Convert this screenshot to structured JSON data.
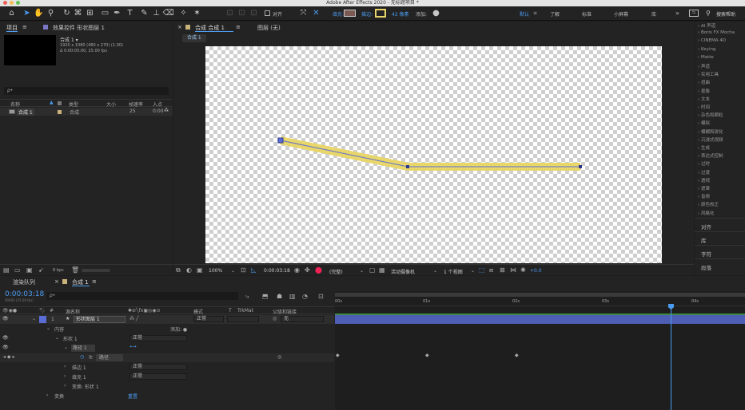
{
  "window": {
    "title": "Adobe After Effects 2020 - 无标题项目 *"
  },
  "toolbar": {
    "snap_label": "对齐",
    "fill_label": "填充:",
    "stroke_label": "描边:",
    "stroke_width": "42 像素",
    "add_label": "添加:",
    "workspaces": [
      "默认",
      "了解",
      "标准",
      "小屏幕",
      "库"
    ],
    "more": "»",
    "search_placeholder": "搜索帮助",
    "colors": {
      "fill": "#7a5a52",
      "stroke": "#e8d66a",
      "accent": "#4b9cf0"
    }
  },
  "project_panel": {
    "tab": "项目",
    "effects_tab": "效果控件 形状图层 1",
    "comp_name": "合成 1 ▾",
    "comp_info1": "1920 x 1080 (480 x 270) (1.00)",
    "comp_info2": "Δ 0:00:05:00, 25.00 fps",
    "search_icon": "ρ•",
    "columns": [
      "名称",
      "类型",
      "大小",
      "帧速率",
      "入点"
    ],
    "items": [
      {
        "name": "合成 1",
        "type": "合成",
        "fps": "25",
        "in": "0:00"
      }
    ],
    "bpc": "8 bpc"
  },
  "comp_viewer": {
    "tab": "合成 合成 1",
    "layer_tab": "图层 (无)",
    "breadcrumb": "合成 1",
    "zoom": "100%",
    "timecode": "0:00:03:18",
    "resolution": "(完整)",
    "camera": "活动摄像机",
    "views": "1 个视图",
    "exposure": "+0.0"
  },
  "effects_list": {
    "items": [
      "AI 声道",
      "Boris FX Mocha",
      "CINEMA 4D",
      "Keying",
      "Matte",
      "声道",
      "实用工具",
      "扭曲",
      "抠像",
      "文本",
      "时间",
      "杂色和颗粒",
      "模拟",
      "模糊和锐化",
      "沉浸式视频",
      "生成",
      "表达式控制",
      "过时",
      "过渡",
      "透视",
      "遮罩",
      "音频",
      "颜色校正",
      "风格化"
    ],
    "panels": [
      "对齐",
      "库",
      "字符",
      "段落"
    ]
  },
  "timeline": {
    "render_tab": "渲染队列",
    "comp_tab": "合成 1",
    "timecode": "0:00:03:18",
    "timecode_sub": "00093 (25.00 fps)",
    "search_icon": "ρ•",
    "col_num": "#",
    "col_source": "源名称",
    "col_mode": "模式",
    "col_t": "T",
    "col_trkmat": "TrkMat",
    "col_parent": "父级和链接",
    "layer": {
      "num": "1",
      "name": "形状图层 1",
      "mode": "正常",
      "parent": "无"
    },
    "rows": [
      {
        "label": "内容",
        "extra": "添加: ●"
      },
      {
        "label": "形状 1",
        "value": "正常"
      },
      {
        "label": "路径 1",
        "value": "⟷"
      },
      {
        "label": "路径"
      },
      {
        "label": "描边 1",
        "value": "正常"
      },
      {
        "label": "填充 1",
        "value": "正常"
      },
      {
        "label": "变换: 形状 1"
      },
      {
        "label": "变换",
        "value": "重置"
      }
    ],
    "ruler": [
      "00s",
      "01s",
      "02s",
      "03s",
      "04s"
    ]
  }
}
